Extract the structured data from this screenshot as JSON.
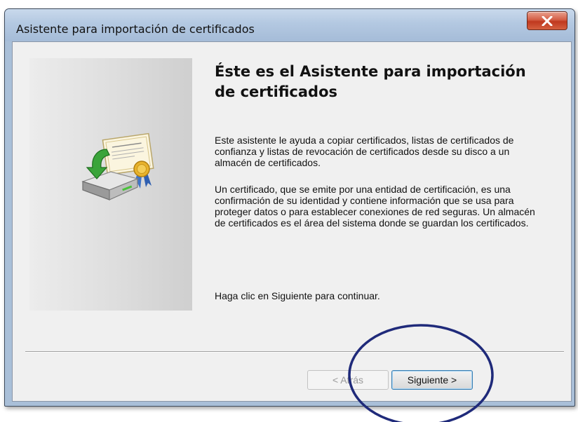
{
  "window": {
    "title": "Asistente para importación de certificados",
    "close_glyph": "x"
  },
  "content": {
    "heading": "Éste es el Asistente para importación de certificados",
    "paragraph_1": "Este asistente le ayuda a copiar certificados, listas de certificados de confianza y listas de revocación de certificados desde su disco a un almacén de certificados.",
    "paragraph_2": "Un certificado, que se emite por una entidad de certificación, es una confirmación de su identidad y contiene información que se usa para proteger datos o para establecer conexiones de red seguras. Un almacén de certificados es el área del sistema donde se guardan los certificados.",
    "paragraph_3": "Haga clic en Siguiente para continuar."
  },
  "buttons": {
    "back_label": "< Atrás",
    "back_enabled": false,
    "next_label": "Siguiente >"
  },
  "icons": {
    "wizard_icon": "certificate-import-icon",
    "close_icon": "close-icon"
  },
  "colors": {
    "titlebar": "#b3c8e1",
    "close_button": "#c0391f",
    "annotation_ellipse": "#1f2a7a",
    "default_button_border": "#3c7fb1"
  }
}
